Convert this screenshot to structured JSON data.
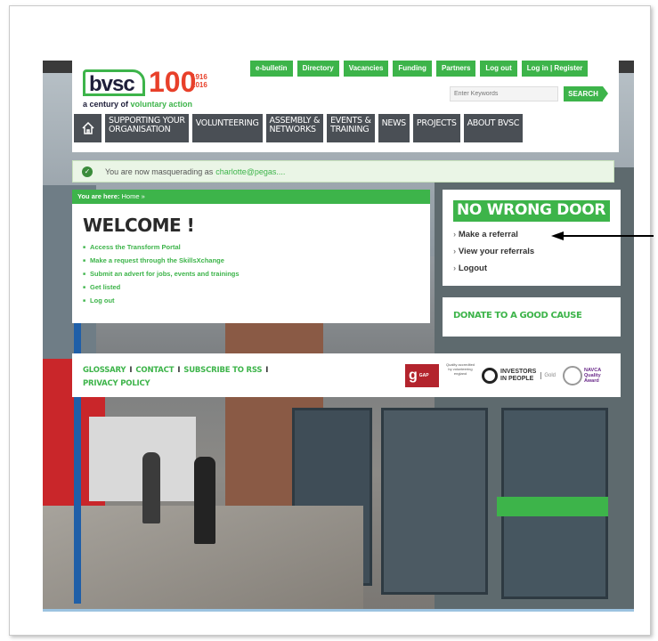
{
  "header": {
    "logo_text": "bvsc",
    "logo_100": "100",
    "logo_years": "1916\n2016",
    "tagline_prefix": "a century of",
    "tagline_accent": "voluntary action",
    "top_links": [
      "e-bulletin",
      "Directory",
      "Vacancies",
      "Funding",
      "Partners",
      "Log out",
      "Log in | Register"
    ],
    "search_placeholder": "Enter Keywords",
    "search_button": "SEARCH",
    "nav": {
      "home_icon": "home-icon",
      "items": [
        "SUPPORTING YOUR\nORGANISATION",
        "VOLUNTEERING",
        "ASSEMBLY &\nNETWORKS",
        "EVENTS &\nTRAINING",
        "NEWS",
        "PROJECTS",
        "ABOUT BVSC"
      ]
    }
  },
  "masquerade": {
    "text": "You are now masquerading as",
    "user": "charlotte@pegas...."
  },
  "welcome": {
    "breadcrumb_label": "You are here:",
    "breadcrumb_link": "Home »",
    "title": "WELCOME !",
    "links": [
      "Access the Transform Portal",
      "Make a request through the SkillsXchange",
      "Submit an advert for jobs, events and trainings",
      "Get listed",
      "Log out"
    ]
  },
  "no_wrong_door": {
    "title": "NO WRONG DOOR",
    "links": [
      "Make a referral",
      "View your referrals",
      "Logout"
    ]
  },
  "donate": {
    "label": "DONATE TO A GOOD CAUSE"
  },
  "footer": {
    "links": [
      "GLOSSARY",
      "CONTACT",
      "SUBSCRIBE TO RSS",
      "PRIVACY POLICY"
    ],
    "separator": "I",
    "badges": {
      "gap": "g",
      "gap_small": "GAP",
      "volunteering": "Quality accredited by volunteering england",
      "investors": "INVESTORS\nIN PEOPLE",
      "investors_level": "Gold",
      "navca": "NAVCA\nQuality\nAward"
    }
  },
  "colors": {
    "brand_green": "#3db44a",
    "nav_grey": "#4a4f55",
    "logo_red": "#e8402a"
  }
}
